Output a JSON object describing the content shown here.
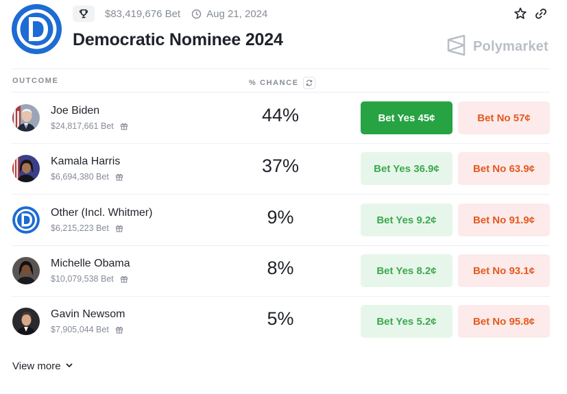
{
  "market": {
    "volume": "$83,419,676 Bet",
    "date": "Aug 21, 2024",
    "title": "Democratic Nominee 2024",
    "brand": "Polymarket",
    "logo_icon": "democratic-party-icon"
  },
  "table": {
    "outcome_header": "OUTCOME",
    "chance_header": "% CHANCE"
  },
  "outcomes": [
    {
      "name": "Joe Biden",
      "volume": "$24,817,661 Bet",
      "chance": "44%",
      "yes": "Bet Yes 45¢",
      "no": "Bet No 57¢"
    },
    {
      "name": "Kamala Harris",
      "volume": "$6,694,380 Bet",
      "chance": "37%",
      "yes": "Bet Yes 36.9¢",
      "no": "Bet No 63.9¢"
    },
    {
      "name": "Other (Incl. Whitmer)",
      "volume": "$6,215,223 Bet",
      "chance": "9%",
      "yes": "Bet Yes 9.2¢",
      "no": "Bet No 91.9¢"
    },
    {
      "name": "Michelle Obama",
      "volume": "$10,079,538 Bet",
      "chance": "8%",
      "yes": "Bet Yes 8.2¢",
      "no": "Bet No 93.1¢"
    },
    {
      "name": "Gavin Newsom",
      "volume": "$7,905,044 Bet",
      "chance": "5%",
      "yes": "Bet Yes 5.2¢",
      "no": "Bet No 95.8¢"
    }
  ],
  "view_more": "View more",
  "colors": {
    "yes_active": "#27a344",
    "yes_bg": "#e7f6ea",
    "yes_text": "#3ba84e",
    "no_bg": "#fcebea",
    "no_text": "#e4581f",
    "dem_blue": "#1d6bd4"
  }
}
